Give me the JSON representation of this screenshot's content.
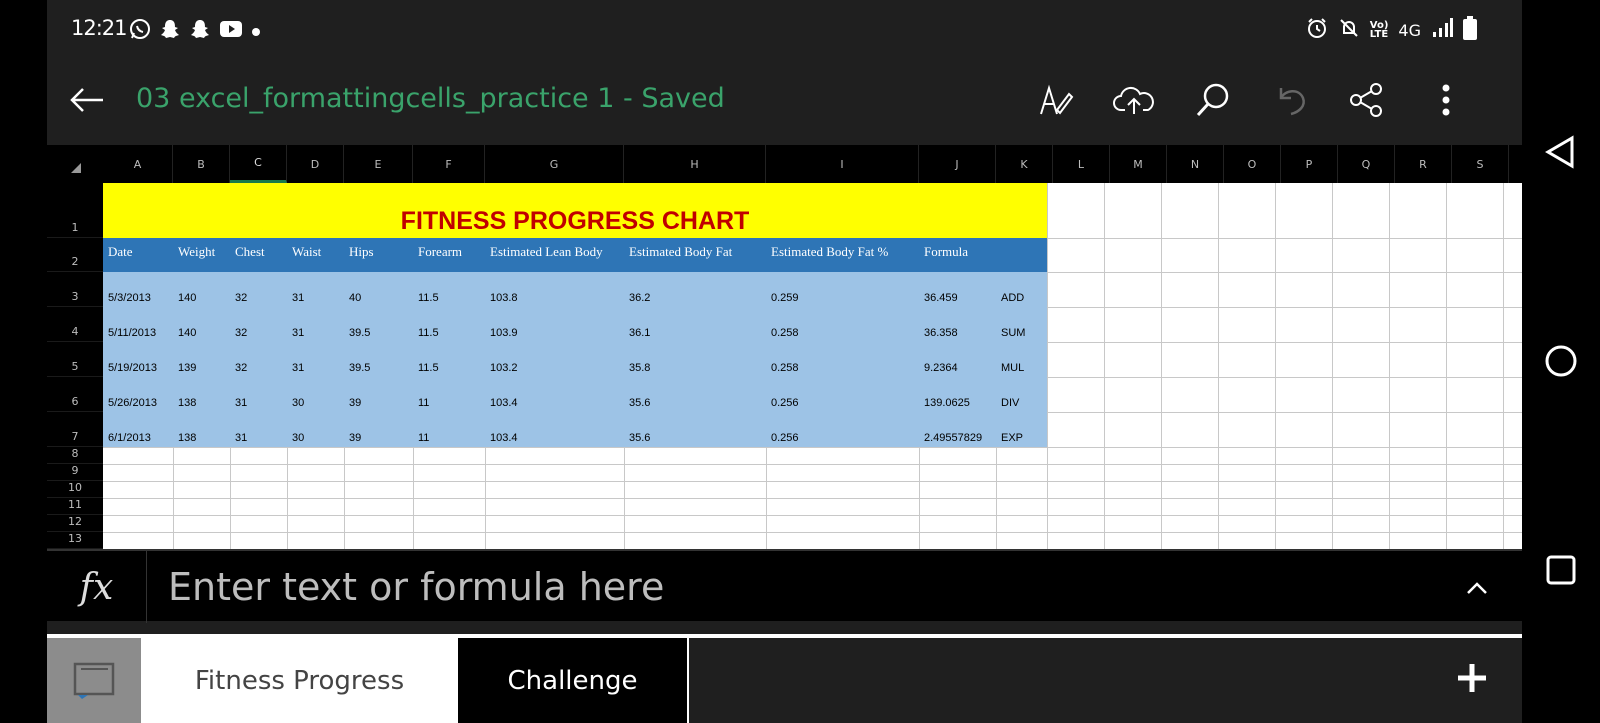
{
  "status_bar": {
    "time": "12:21",
    "network": "4G"
  },
  "titlebar": {
    "document_title": "03 excel_formattingcells_practice 1 - Saved"
  },
  "columns": [
    "A",
    "B",
    "C",
    "D",
    "E",
    "F",
    "G",
    "H",
    "I",
    "J",
    "K",
    "L",
    "M",
    "N",
    "O",
    "P",
    "Q",
    "R",
    "S"
  ],
  "selected_column": "C",
  "rows": [
    "1",
    "2",
    "3",
    "4",
    "5",
    "6",
    "7",
    "8",
    "9",
    "10",
    "11",
    "12",
    "13"
  ],
  "sheet": {
    "title": "FITNESS PROGRESS CHART",
    "headers": [
      "Date",
      "Weight",
      "Chest",
      "Waist",
      "Hips",
      "Forearm",
      "Estimated Lean Body",
      "Estimated Body Fat",
      "Estimated Body Fat %",
      "Formula",
      ""
    ],
    "data": [
      [
        "5/3/2013",
        "140",
        "32",
        "31",
        "40",
        "11.5",
        "103.8",
        "36.2",
        "0.259",
        "36.459",
        "ADD"
      ],
      [
        "5/11/2013",
        "140",
        "32",
        "31",
        "39.5",
        "11.5",
        "103.9",
        "36.1",
        "0.258",
        "36.358",
        "SUM"
      ],
      [
        "5/19/2013",
        "139",
        "32",
        "31",
        "39.5",
        "11.5",
        "103.2",
        "35.8",
        "0.258",
        "9.2364",
        "MUL"
      ],
      [
        "5/26/2013",
        "138",
        "31",
        "30",
        "39",
        "11",
        "103.4",
        "35.6",
        "0.256",
        "139.0625",
        "DIV"
      ],
      [
        "6/1/2013",
        "138",
        "31",
        "30",
        "39",
        "11",
        "103.4",
        "35.6",
        "0.256",
        "2.49557829",
        "EXP"
      ]
    ]
  },
  "formula_bar": {
    "fx_label": "fx",
    "placeholder": "Enter text or formula here"
  },
  "tabs": [
    {
      "label": "Fitness Progress",
      "active": true
    },
    {
      "label": "Challenge",
      "active": false
    }
  ],
  "colors": {
    "title_text": "#3aa36b",
    "title_band": "#ffff00",
    "title_red": "#c00000",
    "header_blue": "#2e75b6",
    "data_blue": "#9dc3e6",
    "accent_green": "#1a7a4a"
  },
  "icons": {
    "status_left": [
      "whatsapp-icon",
      "snapchat-icon",
      "snapchat-icon",
      "youtube-icon",
      "dot-icon"
    ],
    "status_right": [
      "alarm-icon",
      "mute-icon",
      "volte-icon",
      "signal-icon",
      "battery-icon"
    ],
    "toolbar": [
      "draw-icon",
      "cloud-upload-icon",
      "search-icon",
      "undo-icon",
      "share-icon",
      "more-icon"
    ]
  }
}
